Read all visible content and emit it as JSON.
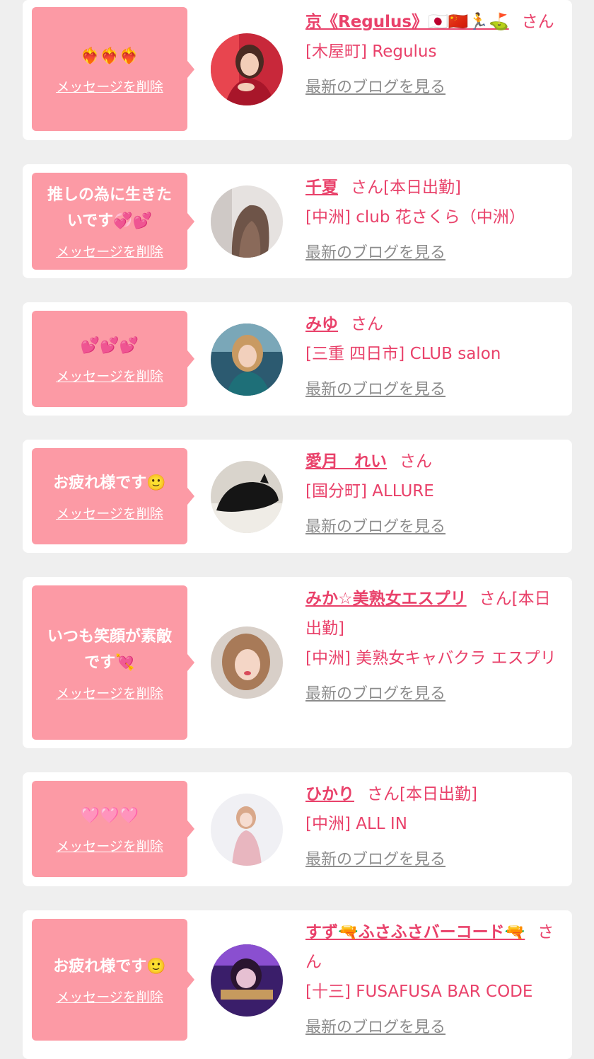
{
  "delete_label": "メッセージを削除",
  "blog_label": "最新のブログを見る",
  "colors": {
    "background": "#efefef",
    "card": "#ffffff",
    "bubble": "#fc9aa5",
    "name": "#e9416a",
    "shop": "#e9416a",
    "blog_link": "#8c8c8c"
  },
  "entries": [
    {
      "message": "❤️‍🔥❤️‍🔥❤️‍🔥",
      "name": "京《Regulus》🇯🇵🇨🇳🏃⛳",
      "suffix": "さん",
      "shop": "[木屋町] Regulus",
      "avatar_icon": "woman-red-dress-photo"
    },
    {
      "message": "推しの為に生きたいです💞💕",
      "name": "千夏",
      "suffix": "さん[本日出勤]",
      "shop": "[中洲] club 花さくら（中洲）",
      "avatar_icon": "woman-back-hair-photo"
    },
    {
      "message": "💕💕💕",
      "name": "みゆ",
      "suffix": "さん",
      "shop": "[三重 四日市] CLUB salon",
      "avatar_icon": "woman-blonde-photo"
    },
    {
      "message": "お疲れ様です🙂",
      "name": "愛月　れい",
      "suffix": "さん",
      "shop": "[国分町] ALLURE",
      "avatar_icon": "black-cat-photo"
    },
    {
      "message": "いつも笑顔が素敵です💘",
      "name": "みか☆美熟女エスプリ",
      "suffix": "さん[本日出勤]",
      "shop": "[中洲] 美熟女キャバクラ エスプリ",
      "avatar_icon": "woman-selfie-photo"
    },
    {
      "message": "🩷🩷🩷",
      "name": "ひかり",
      "suffix": "さん[本日出勤]",
      "shop": "[中洲] ALL IN",
      "avatar_icon": "woman-pink-dress-photo"
    },
    {
      "message": "お疲れ様です🙂",
      "name": "すず🔫ふさふさバーコード🔫",
      "suffix": "さん",
      "shop": "[十三] FUSAFUSA BAR CODE",
      "avatar_icon": "woman-purple-light-photo"
    }
  ]
}
